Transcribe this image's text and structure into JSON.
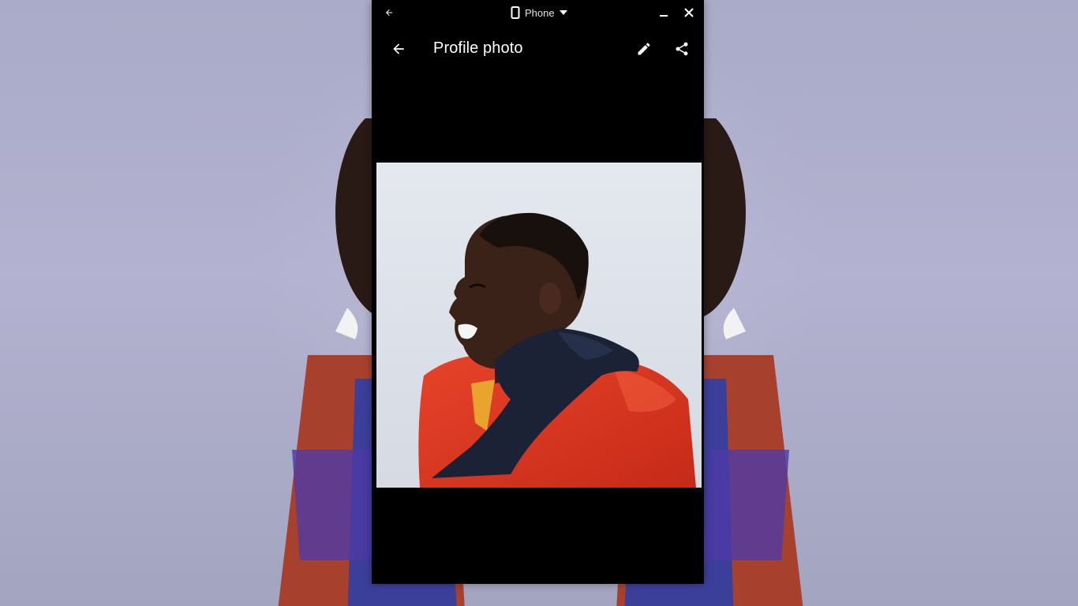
{
  "caption": {
    "device_label": "Phone"
  },
  "appbar": {
    "title": "Profile photo"
  },
  "icons": {
    "caption_back": "arrow-back-icon",
    "device": "phone-icon",
    "dropdown": "dropdown-arrow-icon",
    "minimize": "minimize-icon",
    "close": "close-icon",
    "back": "arrow-back-icon",
    "edit": "pencil-icon",
    "share": "share-icon"
  },
  "colors": {
    "wallpaper": "#a9abc8",
    "window": "#000000",
    "jacket": "#e2381f",
    "scarf": "#1b2236",
    "skin": "#3a2218"
  }
}
